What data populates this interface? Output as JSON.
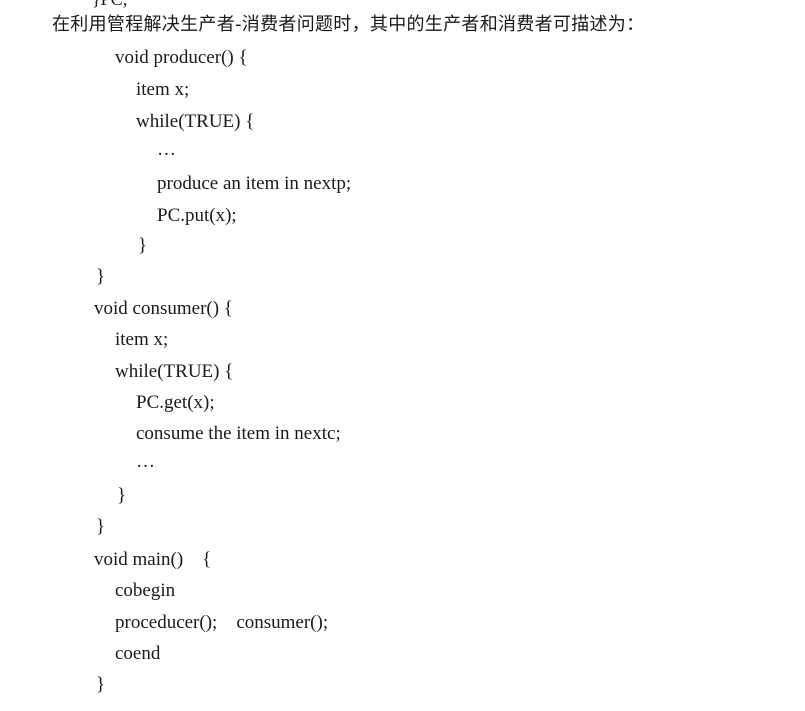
{
  "top_fragment": "}PC;",
  "intro": "在利用管程解决生产者-消费者问题时，其中的生产者和消费者可描述为：",
  "code": [
    "void producer() {",
    "item x;",
    "while(TRUE) {",
    "…",
    "produce an item in nextp;",
    "PC.put(x);",
    "}",
    "}",
    "void consumer() {",
    "item x;",
    "while(TRUE) {",
    "PC.get(x);",
    "consume the item in nextc;",
    "…",
    "}",
    "}",
    "void main()    {",
    "cobegin",
    "proceducer();    consumer();",
    "coend",
    "}"
  ]
}
